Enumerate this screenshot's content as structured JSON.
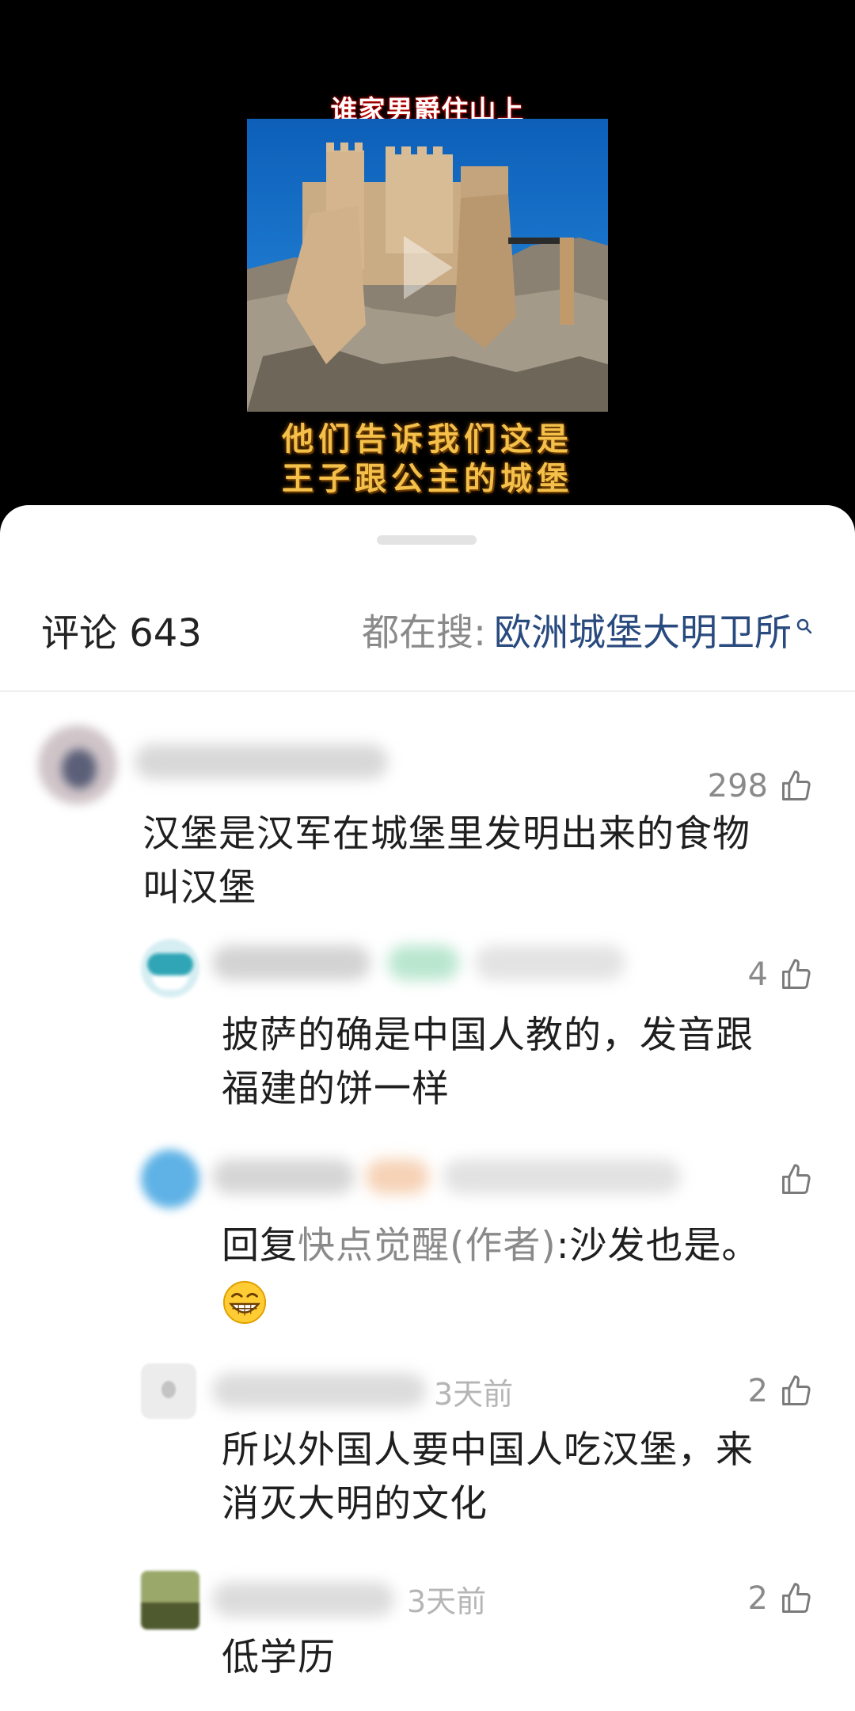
{
  "video": {
    "top_caption": "谁家男爵住山上",
    "bottom_caption_line1": "他们告诉我们这是",
    "bottom_caption_line2": "王子跟公主的城堡"
  },
  "header": {
    "comment_label": "评论 643",
    "search_prefix": "都在搜:",
    "search_keyword": "欧洲城堡大明卫所"
  },
  "comments": [
    {
      "likes": "298",
      "text_line1": "汉堡是汉军在城堡里发明出来的食物",
      "text_line2": "叫汉堡"
    },
    {
      "likes": "4",
      "text_line1": "披萨的确是中国人教的，发音跟",
      "text_line2": "福建的饼一样"
    },
    {
      "likes": "",
      "reply_prefix": "回复",
      "reply_to": "快点觉醒(作者)",
      "text_line1": ":沙发也是。"
    },
    {
      "time": "3天前",
      "likes": "2",
      "text_line1": "所以外国人要中国人吃汉堡，来",
      "text_line2": "消灭大明的文化"
    },
    {
      "time": "3天前",
      "likes": "2",
      "text_line1": "低学历"
    }
  ],
  "colors": {
    "link_blue": "#284a7e",
    "muted_gray": "#8a8a8a",
    "caption_gold": "#f4c04a"
  },
  "icons": [
    "play-icon",
    "search-icon",
    "thumbs-up-icon",
    "grinning-emoji-icon"
  ]
}
